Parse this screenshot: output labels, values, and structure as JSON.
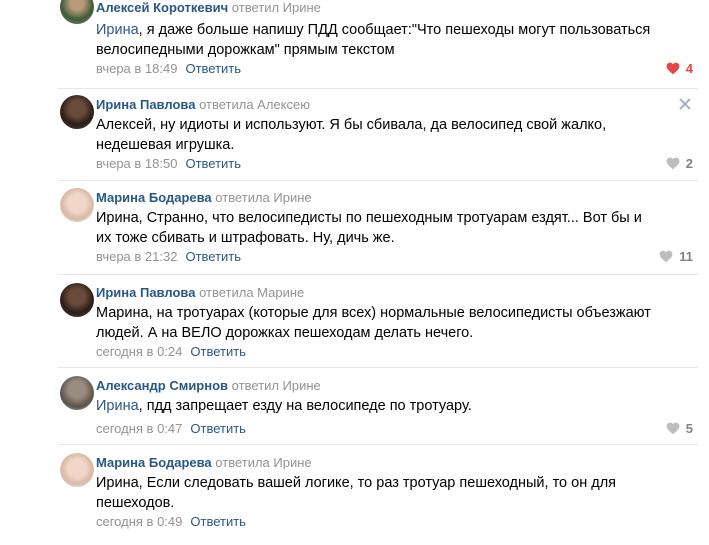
{
  "comments": [
    {
      "author": "Алексей Короткевич",
      "reply_to": "ответил Ирине",
      "mention": "Ирина",
      "text": ", я даже больше напишу ПДД сообщает:\"Что пешеходы могут пользоваться велосипедными дорожкам\" прямым текстом",
      "time": "вчера в 18:49",
      "reply_label": "Ответить",
      "likes": "4",
      "liked": true,
      "colors": {
        "heart": "#e64646"
      }
    },
    {
      "author": "Ирина Павлова",
      "reply_to": "ответила Алексею",
      "mention": "",
      "text": "Алексей, ну идиоты и используют. Я бы сбивала, да велосипед свой жалко, недешевая игрушка.",
      "time": "вчера в 18:50",
      "reply_label": "Ответить",
      "likes": "2",
      "liked": false,
      "has_close": true
    },
    {
      "author": "Марина Бодарева",
      "reply_to": "ответила Ирине",
      "mention": "",
      "text": "Ирина, Странно, что велосипедисты по пешеходным тротуарам ездят... Вот бы и их тоже сбивать и штрафовать. Ну, дичь же.",
      "time": "вчера в 21:32",
      "reply_label": "Ответить",
      "likes": "11",
      "liked": false
    },
    {
      "author": "Ирина Павлова",
      "reply_to": "ответила Марине",
      "mention": "",
      "text": "Марина, на тротуарах (которые для всех) нормальные велосипедисты объезжают людей. А на ВЕЛО дорожках пешеходам делать нечего.",
      "time": "сегодня в 0:24",
      "reply_label": "Ответить",
      "likes": "",
      "liked": false
    },
    {
      "author": "Александр Смирнов",
      "reply_to": "ответил Ирине",
      "mention": "Ирина",
      "text": ", пдд запрещает езду на велосипеде по тротуару.",
      "time": "сегодня в 0:47",
      "reply_label": "Ответить",
      "likes": "5",
      "liked": false
    },
    {
      "author": "Марина Бодарева",
      "reply_to": "ответила Ирине",
      "mention": "",
      "text": "Ирина, Если следовать вашей логике, то раз тротуар пешеходный, то он для пешеходов.",
      "time": "сегодня в 0:49",
      "reply_label": "Ответить",
      "likes": "",
      "liked": false
    }
  ],
  "colors": {
    "link": "#2a5885",
    "muted": "#939393",
    "like_active": "#e64646",
    "like_inactive": "#bdbdbd",
    "divider": "#e7e8ec"
  }
}
